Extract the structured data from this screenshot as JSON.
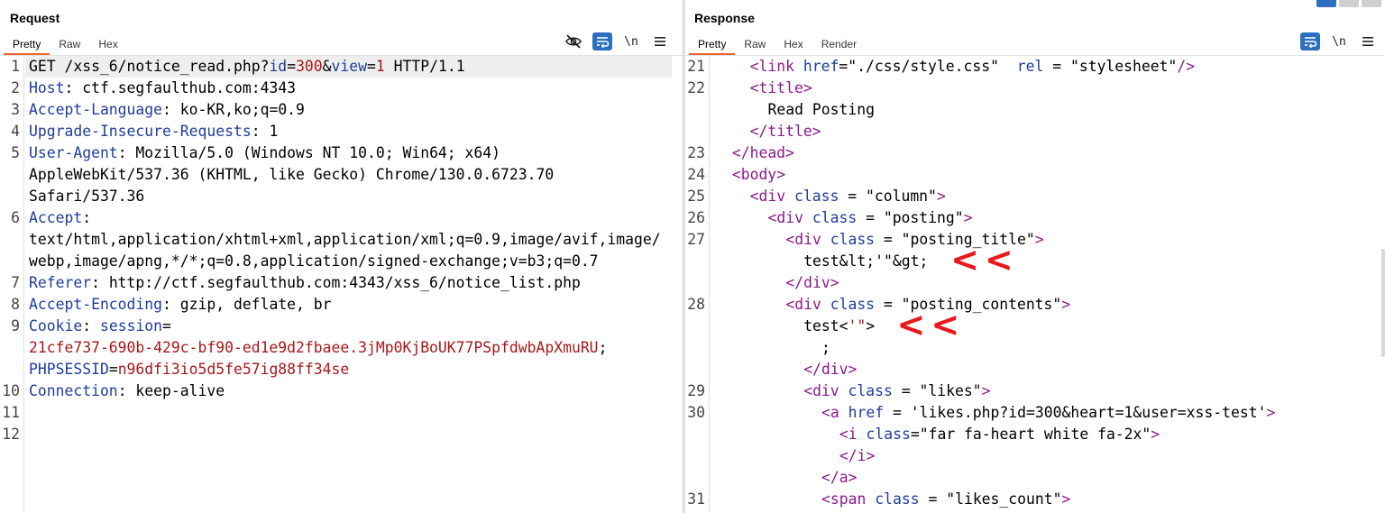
{
  "request": {
    "title": "Request",
    "tabs": [
      {
        "label": "Pretty",
        "active": true
      },
      {
        "label": "Raw",
        "active": false
      },
      {
        "label": "Hex",
        "active": false
      }
    ],
    "tools": {
      "hide_icon": "eye-slash-icon",
      "wrap_icon": "wrap-lines-icon",
      "newline_label": "\\n",
      "menu_icon": "hamburger-menu-icon"
    },
    "lines": [
      {
        "n": "1",
        "parts": [
          [
            "GET /xss_6/notice_read.php?",
            "val"
          ],
          [
            "id",
            "key"
          ],
          [
            "=",
            "val"
          ],
          [
            "300",
            "red"
          ],
          [
            "&",
            "val"
          ],
          [
            "view",
            "key"
          ],
          [
            "=",
            "val"
          ],
          [
            "1",
            "red"
          ],
          [
            " HTTP/1.1",
            "val"
          ]
        ]
      },
      {
        "n": "2",
        "parts": [
          [
            "Host",
            "key"
          ],
          [
            ": ctf.segfaulthub.com:4343",
            "val"
          ]
        ]
      },
      {
        "n": "3",
        "parts": [
          [
            "Accept-Language",
            "key"
          ],
          [
            ": ko-KR,ko;q=0.9",
            "val"
          ]
        ]
      },
      {
        "n": "4",
        "parts": [
          [
            "Upgrade-Insecure-Requests",
            "key"
          ],
          [
            ": 1",
            "val"
          ]
        ]
      },
      {
        "n": "5",
        "parts": [
          [
            "User-Agent",
            "key"
          ],
          [
            ": Mozilla/5.0 (Windows NT 10.0; Win64; x64)",
            "val"
          ]
        ]
      },
      {
        "n": "",
        "parts": [
          [
            "AppleWebKit/537.36 (KHTML, like Gecko) Chrome/130.0.6723.70",
            "val"
          ]
        ]
      },
      {
        "n": "",
        "parts": [
          [
            "Safari/537.36",
            "val"
          ]
        ]
      },
      {
        "n": "6",
        "parts": [
          [
            "Accept",
            "key"
          ],
          [
            ":",
            "val"
          ]
        ]
      },
      {
        "n": "",
        "parts": [
          [
            "text/html,application/xhtml+xml,application/xml;q=0.9,image/avif,image/",
            "val"
          ]
        ]
      },
      {
        "n": "",
        "parts": [
          [
            "webp,image/apng,*/*;q=0.8,application/signed-exchange;v=b3;q=0.7",
            "val"
          ]
        ]
      },
      {
        "n": "7",
        "parts": [
          [
            "Referer",
            "key"
          ],
          [
            ": http://ctf.segfaulthub.com:4343/xss_6/notice_list.php",
            "val"
          ]
        ]
      },
      {
        "n": "8",
        "parts": [
          [
            "Accept-Encoding",
            "key"
          ],
          [
            ": gzip, deflate, br",
            "val"
          ]
        ]
      },
      {
        "n": "9",
        "parts": [
          [
            "Cookie",
            "key"
          ],
          [
            ": ",
            "val"
          ],
          [
            "session",
            "key"
          ],
          [
            "=",
            "val"
          ]
        ]
      },
      {
        "n": "",
        "parts": [
          [
            "21cfe737-690b-429c-bf90-ed1e9d2fbaee.3jMp0KjBoUK77PSpfdwbApXmuRU",
            "red"
          ],
          [
            ";",
            "val"
          ]
        ]
      },
      {
        "n": "",
        "parts": [
          [
            "PHPSESSID",
            "key"
          ],
          [
            "=",
            "val"
          ],
          [
            "n96dfi3io5d5fe57ig88ff34se",
            "red"
          ]
        ]
      },
      {
        "n": "10",
        "parts": [
          [
            "Connection",
            "key"
          ],
          [
            ": keep-alive",
            "val"
          ]
        ]
      },
      {
        "n": "11",
        "parts": []
      },
      {
        "n": "12",
        "parts": []
      }
    ]
  },
  "response": {
    "title": "Response",
    "tabs": [
      {
        "label": "Pretty",
        "active": true
      },
      {
        "label": "Raw",
        "active": false
      },
      {
        "label": "Hex",
        "active": false
      },
      {
        "label": "Render",
        "active": false
      }
    ],
    "tools": {
      "wrap_icon": "wrap-lines-icon",
      "newline_label": "\\n",
      "menu_icon": "hamburger-menu-icon"
    },
    "lines": [
      {
        "n": "21",
        "indent": 4,
        "parts": [
          [
            "<",
            "tag"
          ],
          [
            "link",
            "tag"
          ],
          [
            " href",
            "attr"
          ],
          [
            "=\"./css/style.css\"  ",
            "str"
          ],
          [
            "rel",
            "attr"
          ],
          [
            " = \"stylesheet\"",
            "str"
          ],
          [
            "/>",
            "tag"
          ]
        ]
      },
      {
        "n": "22",
        "indent": 4,
        "parts": [
          [
            "<",
            "tag"
          ],
          [
            "title",
            "tag"
          ],
          [
            ">",
            "tag"
          ]
        ]
      },
      {
        "n": "",
        "indent": 6,
        "parts": [
          [
            "Read Posting",
            "str"
          ]
        ]
      },
      {
        "n": "",
        "indent": 4,
        "parts": [
          [
            "</",
            "tag"
          ],
          [
            "title",
            "tag"
          ],
          [
            ">",
            "tag"
          ]
        ]
      },
      {
        "n": "23",
        "indent": 2,
        "parts": [
          [
            "</",
            "tag"
          ],
          [
            "head",
            "tag"
          ],
          [
            ">",
            "tag"
          ]
        ]
      },
      {
        "n": "24",
        "indent": 2,
        "parts": [
          [
            "<",
            "tag"
          ],
          [
            "body",
            "tag"
          ],
          [
            ">",
            "tag"
          ]
        ]
      },
      {
        "n": "25",
        "indent": 4,
        "parts": [
          [
            "<",
            "tag"
          ],
          [
            "div",
            "tag"
          ],
          [
            " class",
            "attr"
          ],
          [
            " = \"column\"",
            "str"
          ],
          [
            ">",
            "tag"
          ]
        ]
      },
      {
        "n": "26",
        "indent": 6,
        "parts": [
          [
            "<",
            "tag"
          ],
          [
            "div",
            "tag"
          ],
          [
            " class",
            "attr"
          ],
          [
            " = \"posting\"",
            "str"
          ],
          [
            ">",
            "tag"
          ]
        ]
      },
      {
        "n": "27",
        "indent": 8,
        "parts": [
          [
            "<",
            "tag"
          ],
          [
            "div",
            "tag"
          ],
          [
            " class",
            "attr"
          ],
          [
            " = \"posting_title\"",
            "str"
          ],
          [
            ">",
            "tag"
          ]
        ]
      },
      {
        "n": "",
        "indent": 10,
        "parts": [
          [
            "test&lt;'\"&gt;",
            "str"
          ]
        ],
        "arrow": "<<"
      },
      {
        "n": "",
        "indent": 8,
        "parts": [
          [
            "</",
            "tag"
          ],
          [
            "div",
            "tag"
          ],
          [
            ">",
            "tag"
          ]
        ]
      },
      {
        "n": "28",
        "indent": 8,
        "parts": [
          [
            "<",
            "tag"
          ],
          [
            "div",
            "tag"
          ],
          [
            " class",
            "attr"
          ],
          [
            " = \"posting_contents\"",
            "str"
          ],
          [
            ">",
            "tag"
          ]
        ]
      },
      {
        "n": "",
        "indent": 10,
        "parts": [
          [
            "test<",
            "str"
          ],
          [
            "'\"",
            "red"
          ],
          [
            ">",
            "str"
          ]
        ],
        "arrow": "<<"
      },
      {
        "n": "",
        "indent": 12,
        "parts": [
          [
            ";",
            "str"
          ]
        ]
      },
      {
        "n": "",
        "indent": 10,
        "parts": [
          [
            "</",
            "tag"
          ],
          [
            "div",
            "tag"
          ],
          [
            ">",
            "tag"
          ]
        ]
      },
      {
        "n": "29",
        "indent": 10,
        "parts": [
          [
            "<",
            "tag"
          ],
          [
            "div",
            "tag"
          ],
          [
            " class",
            "attr"
          ],
          [
            " = \"likes\"",
            "str"
          ],
          [
            ">",
            "tag"
          ]
        ]
      },
      {
        "n": "30",
        "indent": 12,
        "parts": [
          [
            "<",
            "tag"
          ],
          [
            "a",
            "tag"
          ],
          [
            " href",
            "attr"
          ],
          [
            " = 'likes.php?id=300&heart=1&user=xss-test'",
            "str"
          ],
          [
            ">",
            "tag"
          ]
        ]
      },
      {
        "n": "",
        "indent": 14,
        "parts": [
          [
            "<",
            "tag"
          ],
          [
            "i",
            "tag"
          ],
          [
            " class",
            "attr"
          ],
          [
            "=\"far fa-heart white fa-2x\"",
            "str"
          ],
          [
            ">",
            "tag"
          ]
        ]
      },
      {
        "n": "",
        "indent": 14,
        "parts": [
          [
            "</",
            "tag"
          ],
          [
            "i",
            "tag"
          ],
          [
            ">",
            "tag"
          ]
        ]
      },
      {
        "n": "",
        "indent": 12,
        "parts": [
          [
            "</",
            "tag"
          ],
          [
            "a",
            "tag"
          ],
          [
            ">",
            "tag"
          ]
        ]
      },
      {
        "n": "31",
        "indent": 12,
        "parts": [
          [
            "<",
            "tag"
          ],
          [
            "span",
            "tag"
          ],
          [
            " class",
            "attr"
          ],
          [
            " = \"likes_count\"",
            "str"
          ],
          [
            ">",
            "tag"
          ]
        ]
      }
    ]
  },
  "colors": {
    "accent": "#e8622e",
    "wrap_button": "#2c6fbf",
    "annotation_arrow": "#e8191c"
  }
}
